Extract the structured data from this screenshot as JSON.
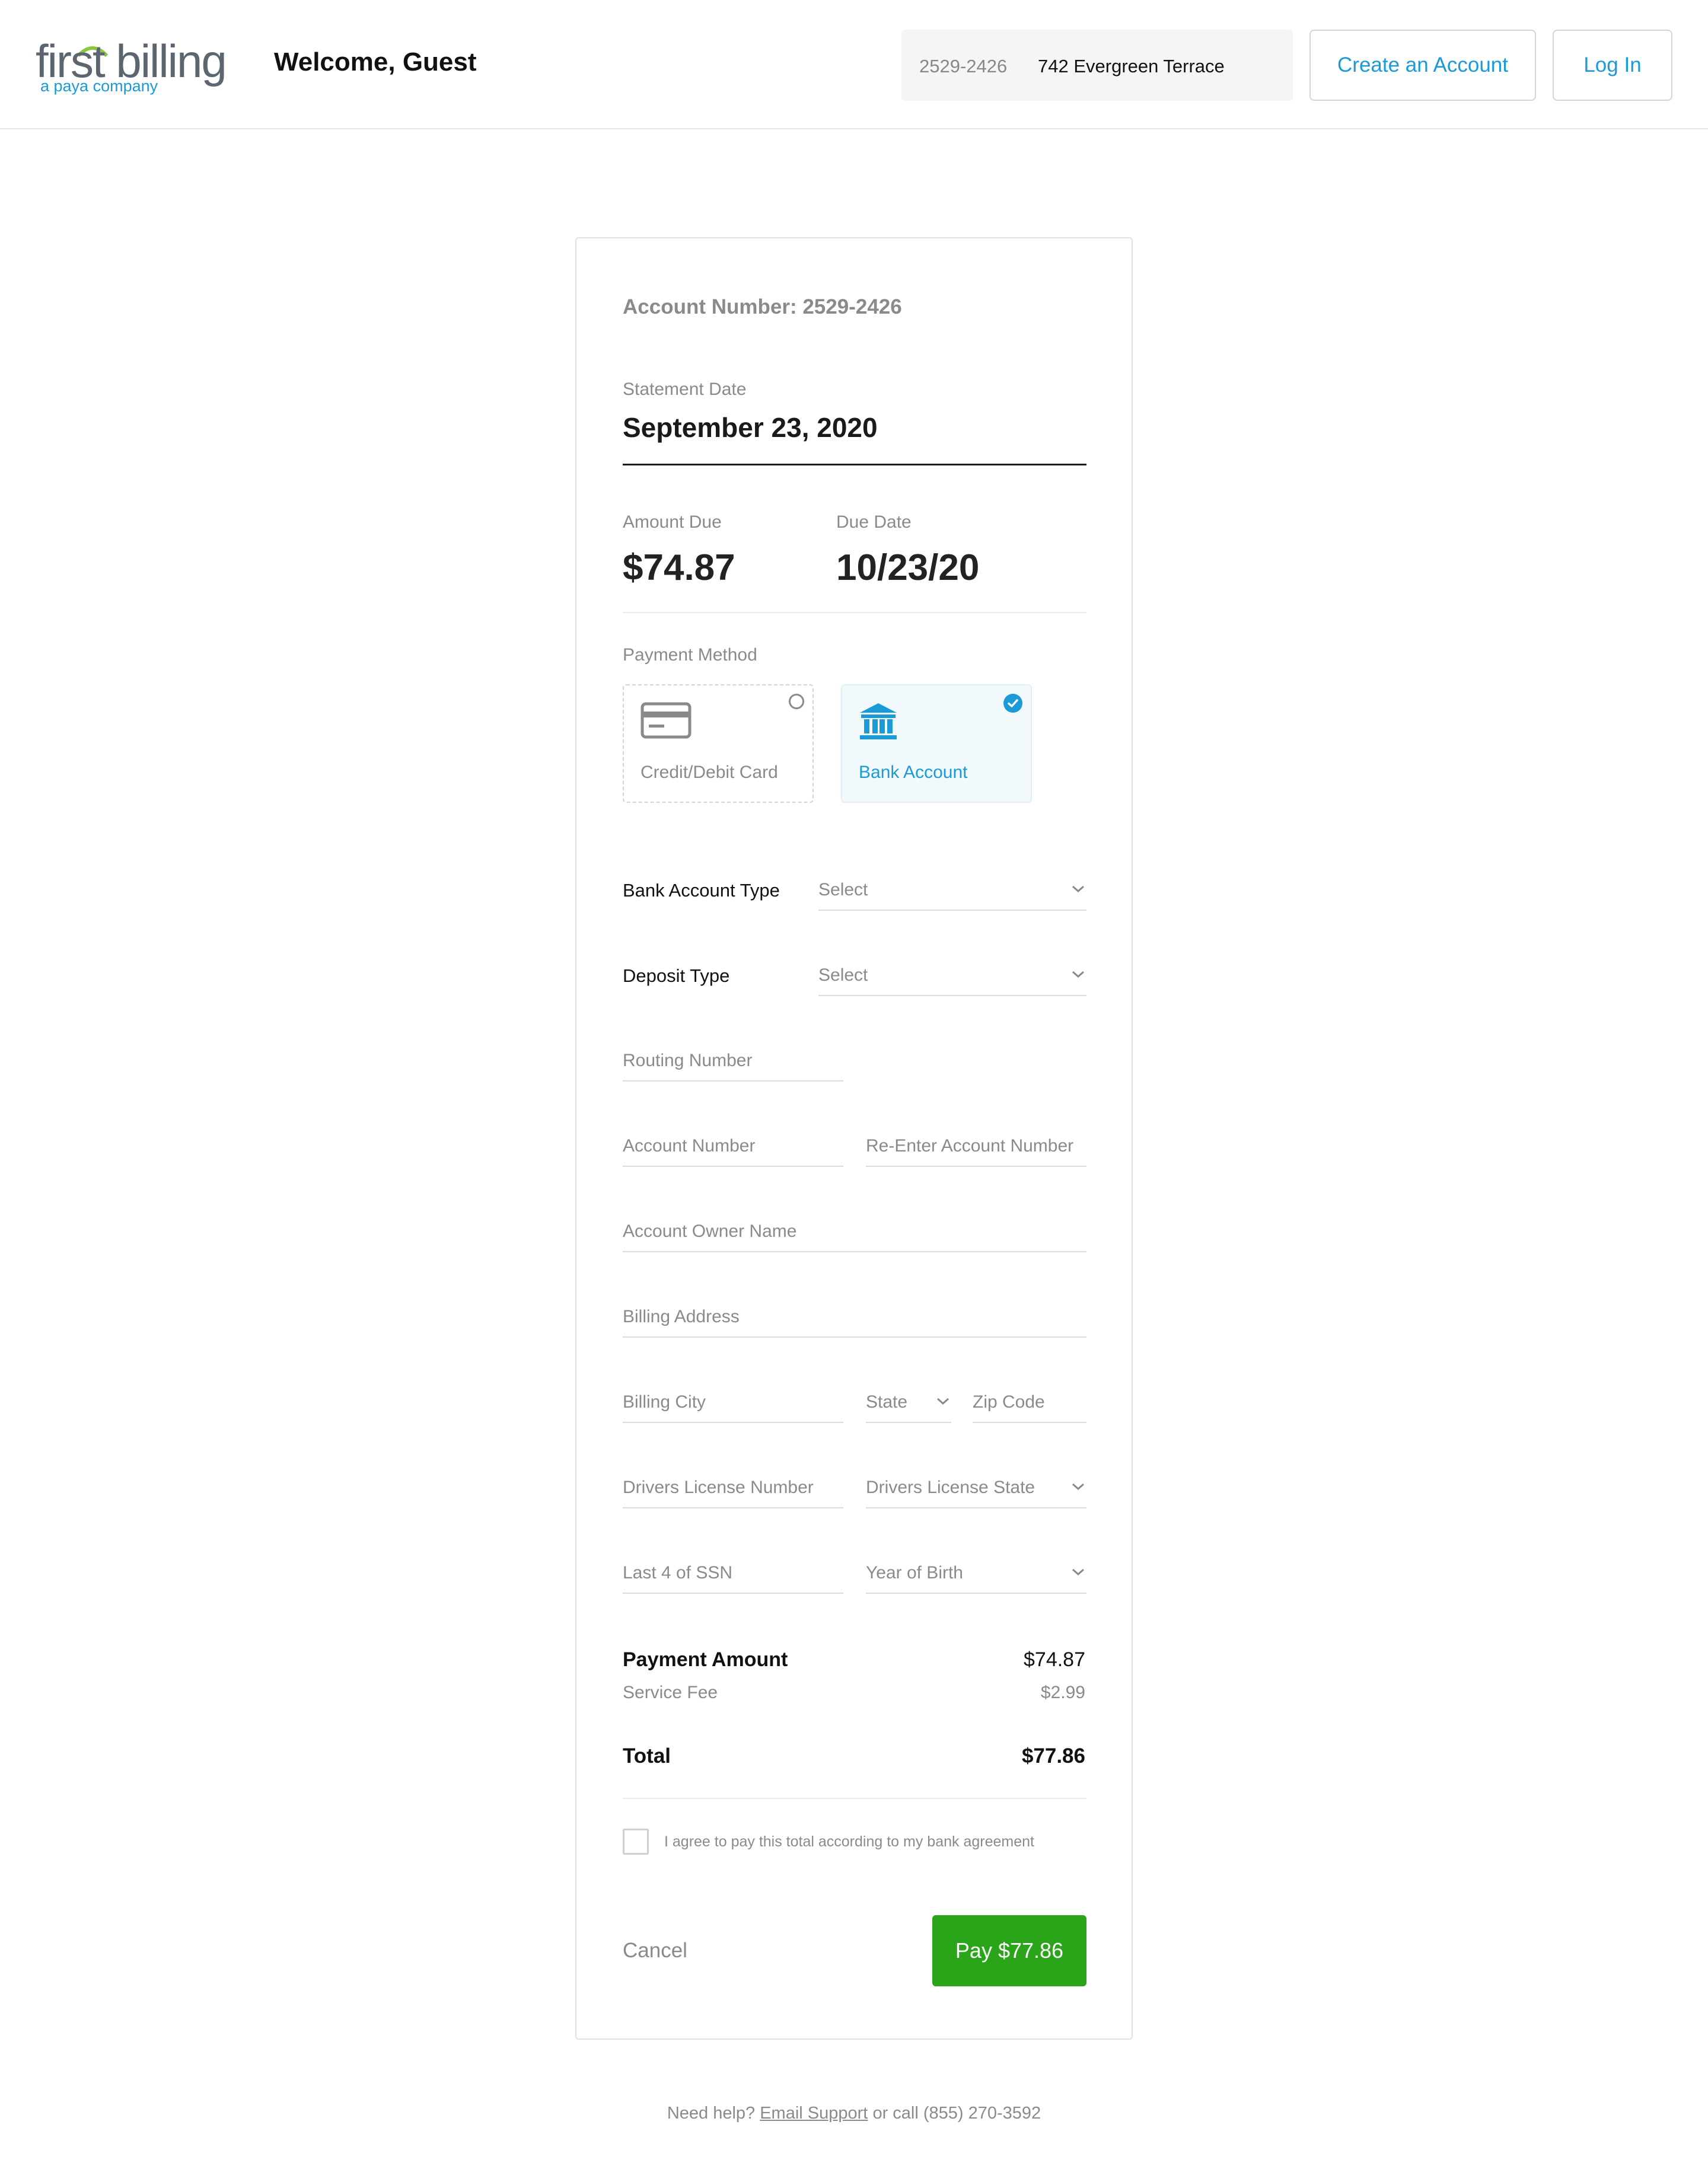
{
  "header": {
    "logo": {
      "brand": "first billing",
      "sub": "a paya company"
    },
    "welcome": "Welcome, Guest",
    "account_pill": {
      "number": "2529-2426",
      "address": "742 Evergreen Terrace"
    },
    "create_account": "Create an Account",
    "login": "Log In"
  },
  "card": {
    "account_title": "Account Number: 2529-2426",
    "statement_label": "Statement Date",
    "statement_date": "September 23, 2020",
    "amount_due_label": "Amount Due",
    "amount_due": "$74.87",
    "due_date_label": "Due Date",
    "due_date": "10/23/20",
    "payment_method_label": "Payment Method",
    "methods": {
      "credit": "Credit/Debit Card",
      "bank": "Bank Account",
      "selected": "Bank Account"
    },
    "form": {
      "bank_account_type_label": "Bank Account Type",
      "bank_account_type_value": "Select",
      "deposit_type_label": "Deposit Type",
      "deposit_type_value": "Select",
      "routing": "Routing Number",
      "account_number": "Account Number",
      "reenter_account": "Re-Enter Account Number",
      "owner_name": "Account Owner Name",
      "billing_address": "Billing Address",
      "billing_city": "Billing City",
      "state": "State",
      "zip": "Zip Code",
      "dl_number": "Drivers License Number",
      "dl_state": "Drivers License State",
      "ssn": "Last 4 of SSN",
      "birth_year": "Year of Birth"
    },
    "summary": {
      "payment_amount_label": "Payment Amount",
      "payment_amount": "$74.87",
      "service_fee_label": "Service Fee",
      "service_fee": "$2.99",
      "total_label": "Total",
      "total": "$77.86"
    },
    "agree_text": "I agree to pay this total according to my bank agreement",
    "cancel": "Cancel",
    "pay": "Pay $77.86"
  },
  "footer": {
    "prefix": "Need help?",
    "link": "Email Support",
    "suffix": "or call (855) 270-3592"
  },
  "colors": {
    "accent": "#1a9ad6",
    "pay_button": "#2aa51a",
    "muted": "#8a8a8a"
  }
}
